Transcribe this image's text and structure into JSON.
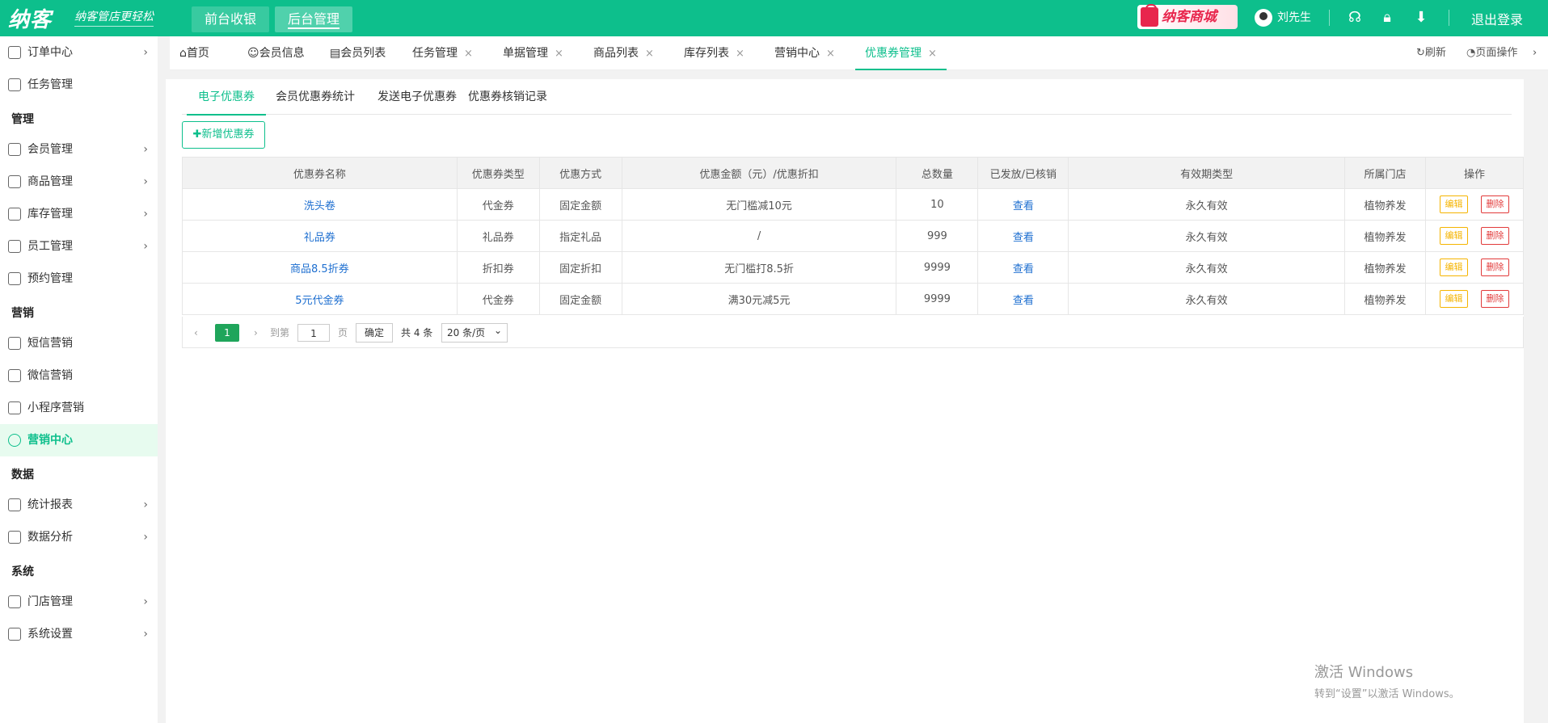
{
  "header": {
    "logo": "纳客",
    "slogan": "纳客管店更轻松",
    "tabs": [
      "前台收银",
      "后台管理"
    ],
    "mall": "纳客商城",
    "user": "刘先生",
    "logout": "退出登录"
  },
  "sidebar": {
    "items": [
      {
        "label": "订单中心"
      },
      {
        "label": "任务管理"
      },
      {
        "label": "会员管理"
      },
      {
        "label": "商品管理"
      },
      {
        "label": "库存管理"
      },
      {
        "label": "员工管理"
      },
      {
        "label": "预约管理"
      },
      {
        "label": "短信营销"
      },
      {
        "label": "微信营销"
      },
      {
        "label": "小程序营销"
      },
      {
        "label": "营销中心"
      },
      {
        "label": "统计报表"
      },
      {
        "label": "数据分析"
      },
      {
        "label": "门店管理"
      },
      {
        "label": "系统设置"
      }
    ],
    "sections": [
      "管理",
      "营销",
      "数据",
      "系统"
    ]
  },
  "tabs": {
    "items": [
      "首页",
      "会员信息",
      "会员列表",
      "任务管理",
      "单据管理",
      "商品列表",
      "库存列表",
      "营销中心",
      "优惠券管理"
    ],
    "refresh": "刷新",
    "page_ops": "页面操作"
  },
  "subtabs": [
    "电子优惠券",
    "会员优惠券统计",
    "发送电子优惠券",
    "优惠券核销记录"
  ],
  "add_button": "新增优惠券",
  "table": {
    "headers": [
      "优惠券名称",
      "优惠券类型",
      "优惠方式",
      "优惠金额（元）/优惠折扣",
      "总数量",
      "已发放/已核销",
      "有效期类型",
      "所属门店",
      "操作"
    ],
    "rows": [
      {
        "name": "洗头卷",
        "type": "代金券",
        "method": "固定金额",
        "amount": "无门槛减10元",
        "total": "10",
        "view": "查看",
        "validity": "永久有效",
        "store": "植物养发"
      },
      {
        "name": "礼品券",
        "type": "礼品券",
        "method": "指定礼品",
        "amount": "/",
        "total": "999",
        "view": "查看",
        "validity": "永久有效",
        "store": "植物养发"
      },
      {
        "name": "商品8.5折券",
        "type": "折扣券",
        "method": "固定折扣",
        "amount": "无门槛打8.5折",
        "total": "9999",
        "view": "查看",
        "validity": "永久有效",
        "store": "植物养发"
      },
      {
        "name": "5元代金券",
        "type": "代金券",
        "method": "固定金额",
        "amount": "满30元减5元",
        "total": "9999",
        "view": "查看",
        "validity": "永久有效",
        "store": "植物养发"
      }
    ],
    "edit": "编辑",
    "delete": "删除"
  },
  "pager": {
    "current": "1",
    "goto": "到第",
    "page_value": "1",
    "page_unit": "页",
    "confirm": "确定",
    "total": "共 4 条",
    "per_page": "20 条/页"
  },
  "watermark": {
    "line1": "激活 Windows",
    "line2": "转到“设置”以激活 Windows。"
  }
}
